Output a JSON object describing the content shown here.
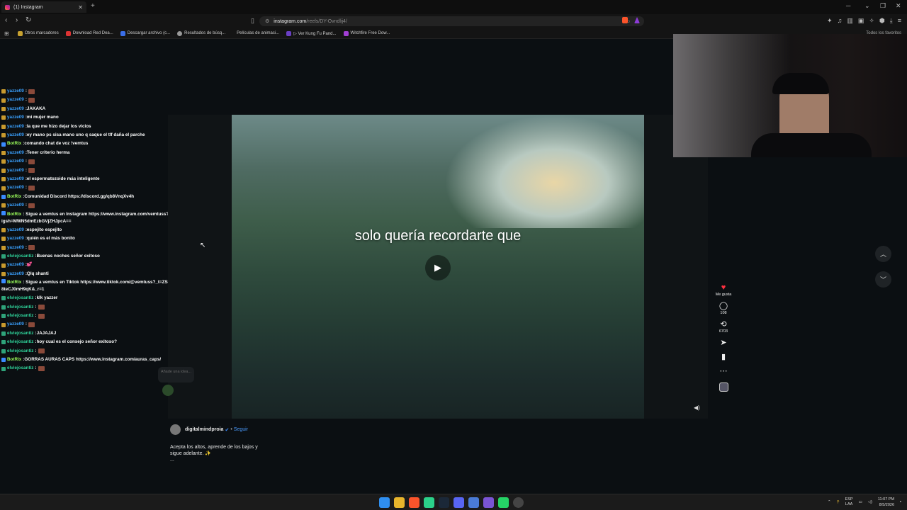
{
  "browser": {
    "tab_title": "(1) Instagram",
    "url_host": "instagram.com",
    "url_path": "/reels/DY-Ovndlij4/",
    "bookmarks": [
      "Otros marcadores",
      "Download Red Dea...",
      "Descargar archivo (c...",
      "Resultados de búsq...",
      "Películas de animaci...",
      "▷ Ver Kung Fu Pand...",
      "Witchfire Free Dow..."
    ],
    "bookmarks_right": "Todos los favoritos"
  },
  "chat": [
    {
      "user": "yazze09",
      "msg": "",
      "emote": true,
      "color": "#3aa1ff",
      "badge": "#c89a2e"
    },
    {
      "user": "yazze09",
      "msg": "",
      "emote": true,
      "color": "#3aa1ff",
      "badge": "#c89a2e"
    },
    {
      "user": "yazze09",
      "msg": "JAKAKA",
      "emote": false,
      "color": "#3aa1ff",
      "badge": "#c89a2e"
    },
    {
      "user": "yazze09",
      "msg": "mi mujer mano",
      "emote": false,
      "color": "#3aa1ff",
      "badge": "#c89a2e"
    },
    {
      "user": "yazze09",
      "msg": "la que me hizo dejar los vicios",
      "emote": false,
      "color": "#3aa1ff",
      "badge": "#c89a2e"
    },
    {
      "user": "yazze09",
      "msg": "ey mano ps sisa mano uno q saque el tlf daña el parche",
      "emote": false,
      "color": "#3aa1ff",
      "badge": "#c89a2e"
    },
    {
      "user": "BotRix",
      "msg": "comando chat de voz !vemtus",
      "emote": false,
      "color": "#9cff5a",
      "badge": "#3a8bff"
    },
    {
      "user": "yazze09",
      "msg": "Tener criterio herma",
      "emote": false,
      "color": "#3aa1ff",
      "badge": "#c89a2e"
    },
    {
      "user": "yazze09",
      "msg": "",
      "emote": true,
      "color": "#3aa1ff",
      "badge": "#c89a2e"
    },
    {
      "user": "yazze09",
      "msg": "",
      "emote": true,
      "color": "#3aa1ff",
      "badge": "#c89a2e"
    },
    {
      "user": "yazze09",
      "msg": "el espermatozoide más inteligente",
      "emote": false,
      "color": "#3aa1ff",
      "badge": "#c89a2e"
    },
    {
      "user": "yazze09",
      "msg": "",
      "emote": true,
      "color": "#3aa1ff",
      "badge": "#c89a2e"
    },
    {
      "user": "BotRix",
      "msg": "Comunidad Discord https://discord.gg/qb8VnqXv4h",
      "emote": false,
      "color": "#9cff5a",
      "badge": "#3a8bff"
    },
    {
      "user": "yazze09",
      "msg": "",
      "emote": true,
      "color": "#3aa1ff",
      "badge": "#c89a2e"
    },
    {
      "user": "BotRix",
      "msg": "Sigue a vemtus en Instagram https://www.instagram.com/vemtuss?igsh=MWN5dmEzbGVjZHJpcA==",
      "emote": false,
      "color": "#9cff5a",
      "badge": "#3a8bff",
      "wrap": true
    },
    {
      "user": "yazze09",
      "msg": "espejito espejito",
      "emote": false,
      "color": "#3aa1ff",
      "badge": "#c89a2e"
    },
    {
      "user": "yazze09",
      "msg": "quién es el más bonito",
      "emote": false,
      "color": "#3aa1ff",
      "badge": "#c89a2e"
    },
    {
      "user": "yazze09",
      "msg": "",
      "emote": true,
      "color": "#3aa1ff",
      "badge": "#c89a2e"
    },
    {
      "user": "elviejosantiz",
      "msg": "Buenas noches señor exitoso",
      "emote": false,
      "color": "#2fd39a",
      "badge": "#2fa37a"
    },
    {
      "user": "yazze09",
      "msg": "💕",
      "emote": false,
      "color": "#3aa1ff",
      "badge": "#c89a2e"
    },
    {
      "user": "yazze09",
      "msg": "Qlq shanti",
      "emote": false,
      "color": "#3aa1ff",
      "badge": "#c89a2e"
    },
    {
      "user": "BotRix",
      "msg": "Sigue a vemtus en Tiktok https://www.tiktok.com/@vemtuss?_t=ZS-8teCJ0mH9qK&_r=1",
      "emote": false,
      "color": "#9cff5a",
      "badge": "#3a8bff",
      "wrap": true
    },
    {
      "user": "elviejosantiz",
      "msg": "klk yazzer",
      "emote": false,
      "color": "#2fd39a",
      "badge": "#2fa37a"
    },
    {
      "user": "elviejosantiz",
      "msg": "",
      "emote": true,
      "color": "#2fd39a",
      "badge": "#2fa37a"
    },
    {
      "user": "elviejosantiz",
      "msg": "",
      "emote": true,
      "color": "#2fd39a",
      "badge": "#2fa37a"
    },
    {
      "user": "yazze09",
      "msg": "",
      "emote": true,
      "color": "#3aa1ff",
      "badge": "#c89a2e"
    },
    {
      "user": "elviejosantiz",
      "msg": "JAJAJAJ",
      "emote": false,
      "color": "#2fd39a",
      "badge": "#2fa37a"
    },
    {
      "user": "elviejosantiz",
      "msg": "hoy cual es el consejo señor exitoso?",
      "emote": false,
      "color": "#2fd39a",
      "badge": "#2fa37a"
    },
    {
      "user": "elviejosantiz",
      "msg": "",
      "emote": true,
      "color": "#2fd39a",
      "badge": "#2fa37a"
    },
    {
      "user": "BotRix",
      "msg": "GORRAS AURAS CAPS https://www.instagram.com/auras_caps/",
      "emote": false,
      "color": "#9cff5a",
      "badge": "#3a8bff"
    },
    {
      "user": "elviejosantiz",
      "msg": "",
      "emote": true,
      "color": "#2fd39a",
      "badge": "#2fa37a"
    }
  ],
  "reel": {
    "caption_overlay": "solo quería recordarte que",
    "likes_label": "Me gusta",
    "comments_count": "108",
    "shares_count": "6703",
    "author": "digitalmindproia",
    "follow_label": "Seguir",
    "description": "Acepta los altos, aprende de los bajos y sigue adelante. ✨",
    "more": "..."
  },
  "idea_placeholder": "Añade una idea...",
  "taskbar": {
    "lang_top": "ESP",
    "lang_bottom": "LAA",
    "time": "11:07 PM",
    "date": "8/5/2026"
  },
  "icons": {
    "like": "heart-icon",
    "comment": "comment-icon",
    "repost": "repost-icon",
    "share": "send-icon",
    "save": "bookmark-icon",
    "more": "more-icon"
  }
}
